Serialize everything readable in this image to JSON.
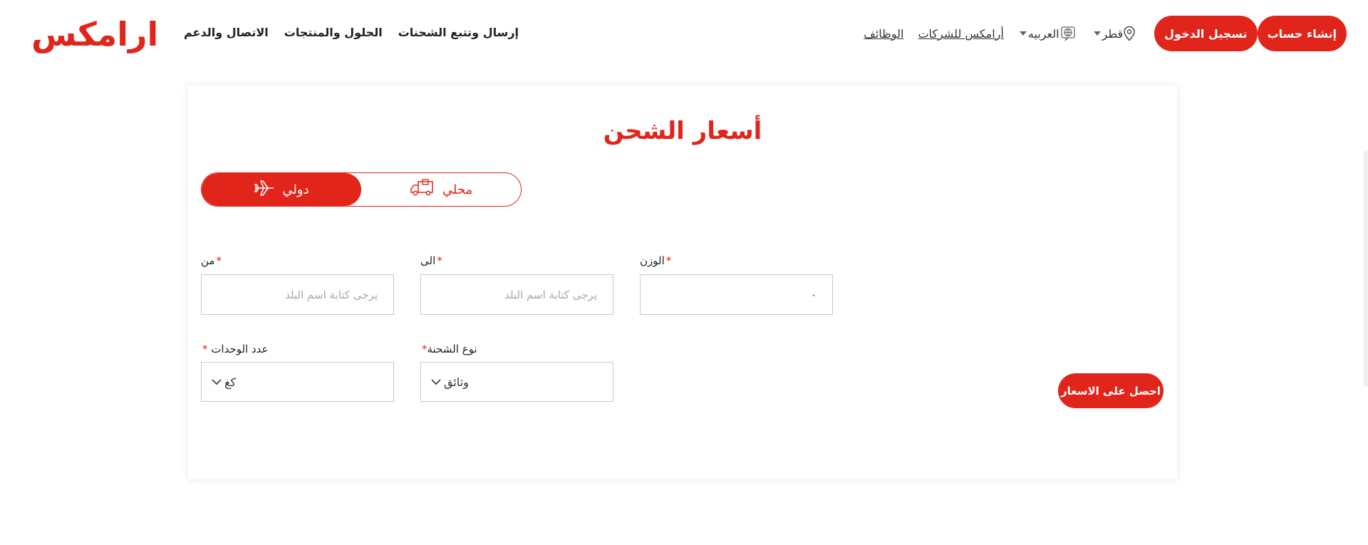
{
  "colors": {
    "brand": "#e1251b",
    "text": "#222222"
  },
  "header": {
    "logo_text": "ارامكس",
    "main_nav": [
      "إرسال وتتبع الشحنات",
      "الحلول والمنتجات",
      "الاتصال والدعم"
    ],
    "create_account": "إنشاء حساب",
    "sign_in": "تسجيل الدخول",
    "country": "قطر",
    "language": "العربيه",
    "business": "أرامكس للشركات",
    "careers": "الوظائف"
  },
  "form": {
    "title": "أسعار الشحن",
    "tab_international": "دولي",
    "tab_local": "محلي",
    "from_label": "من",
    "to_label": "الى",
    "weight_label": "الوزن",
    "required_mark": "*",
    "from_placeholder": "يرجى كتابة اسم البلد",
    "to_placeholder": "يرجى كتابة اسم البلد",
    "weight_value": "٠",
    "units_label": "عدد الوحدات",
    "units_value": "كغ",
    "shipment_type_label": "نوع الشحنة",
    "shipment_type_value": "وثائق",
    "submit": "احصل على الاسعار"
  }
}
